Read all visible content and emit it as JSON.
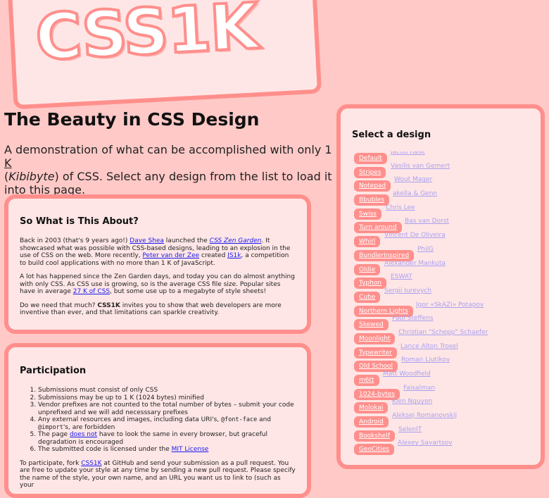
{
  "logo": {
    "text": "CSS1K"
  },
  "title": "The Beauty in CSS Design",
  "intro": {
    "a": "A demonstration of what can be accomplished with only 1 ",
    "unit": "K",
    "b": " (",
    "kib": "Kibibyte",
    "c": ") of CSS. Select any design from the list to load it into this page."
  },
  "about": {
    "heading": "So What is This About?",
    "p1": {
      "a": "Back in 2003 (that's 9 years ago!) ",
      "link1": "Dave Shea",
      "b": " launched the ",
      "link2": "CSS Zen Garden",
      "c": ". It showcased what was possible with CSS-based designs, leading to an explosion in the use of CSS on the web. More recently, ",
      "link3": "Peter van der Zee",
      "d": " created ",
      "link4": "JS1k",
      "e": ", a competition to build cool applications with no more than 1 K of JavaScript."
    },
    "p2": {
      "a": "A lot has happened since the Zen Garden days, and today you can do almost anything with only CSS. As CSS use is growing, so is the average CSS file size. Popular sites have in average ",
      "link": "27 K of CSS",
      "b": ", but some use up to a megabyte of style sheets!"
    },
    "p3": {
      "a": "Do we need that much? ",
      "strong": "CSS1K",
      "b": " invites you to show that web developers are more inventive than ever, and that limitations can sparkle creativity."
    }
  },
  "participation": {
    "heading": "Participation",
    "rules": {
      "r1": "Submissions must consist of only CSS",
      "r2": "Submissions may be up to 1 K (1024 bytes) minified",
      "r3": "Vendor prefixes are not counted to the total number of bytes – submit your code unprefixed and we will add necesssary prefixes",
      "r4a": "Any external resources and images, including data URI's, ",
      "r4code1": "@font-face",
      "r4b": " and ",
      "r4code2": "@import",
      "r4c": "'s, are forbidden",
      "r5a": "The page ",
      "r5link": "does not",
      "r5b": " have to look the same in every browser, but graceful degradation is encouraged",
      "r6a": "The submitted code is licensed under the ",
      "r6link": "MIT License"
    },
    "foot": {
      "a": "To participate, fork ",
      "link": "CSS1K",
      "b": " at GitHub and send your submission as a pull request. You are free to update your style at any time by sending a new pull request. Please specify the name of the style, your own name, and an URL you want us to link to (such as your"
    }
  },
  "selector": {
    "title": "Select a design",
    "designs": [
      {
        "name": "Default",
        "author": "Jacob Rask"
      },
      {
        "name": "Stripes",
        "author": "Vasilis van Gemert"
      },
      {
        "name": "Notepad",
        "author": "Wout Mager"
      },
      {
        "name": "Bbubles",
        "author": "akella & Genn"
      },
      {
        "name": "Swiss",
        "author": "Chris Lee"
      },
      {
        "name": "Turn around",
        "author": "Bas van Dorst"
      },
      {
        "name": "Whirl",
        "author": "Vincent De Oliveira"
      },
      {
        "name": "BundlerInspired",
        "author": "PhilG"
      },
      {
        "name": "Oldie",
        "author": "Alexander Mankuta"
      },
      {
        "name": "Typhon",
        "author": "ESWAT"
      },
      {
        "name": "Cube",
        "author": "Sergii Iurevych"
      },
      {
        "name": "Northern Lights",
        "author": "Igor «SkAZi» Potapov"
      },
      {
        "name": "Skewed",
        "author": "Paul Steffens"
      },
      {
        "name": "Moonlight",
        "author": "Christian \"Schepp\" Schaefer"
      },
      {
        "name": "Typewriter",
        "author": "Lance Alton Troxel"
      },
      {
        "name": "Old School",
        "author": "Roman Liutikov"
      },
      {
        "name": "m6tt",
        "author": "Matt Woodfield"
      },
      {
        "name": "1024-bytes",
        "author": "Faisalman"
      },
      {
        "name": "Molokai",
        "author": "Kien Nguyen"
      },
      {
        "name": "Android",
        "author": "Aleksej Romanovskij"
      },
      {
        "name": "Bookshelf",
        "author": "SelenIT"
      },
      {
        "name": "GeoCities",
        "author": "Alexey Savartsov"
      }
    ]
  }
}
